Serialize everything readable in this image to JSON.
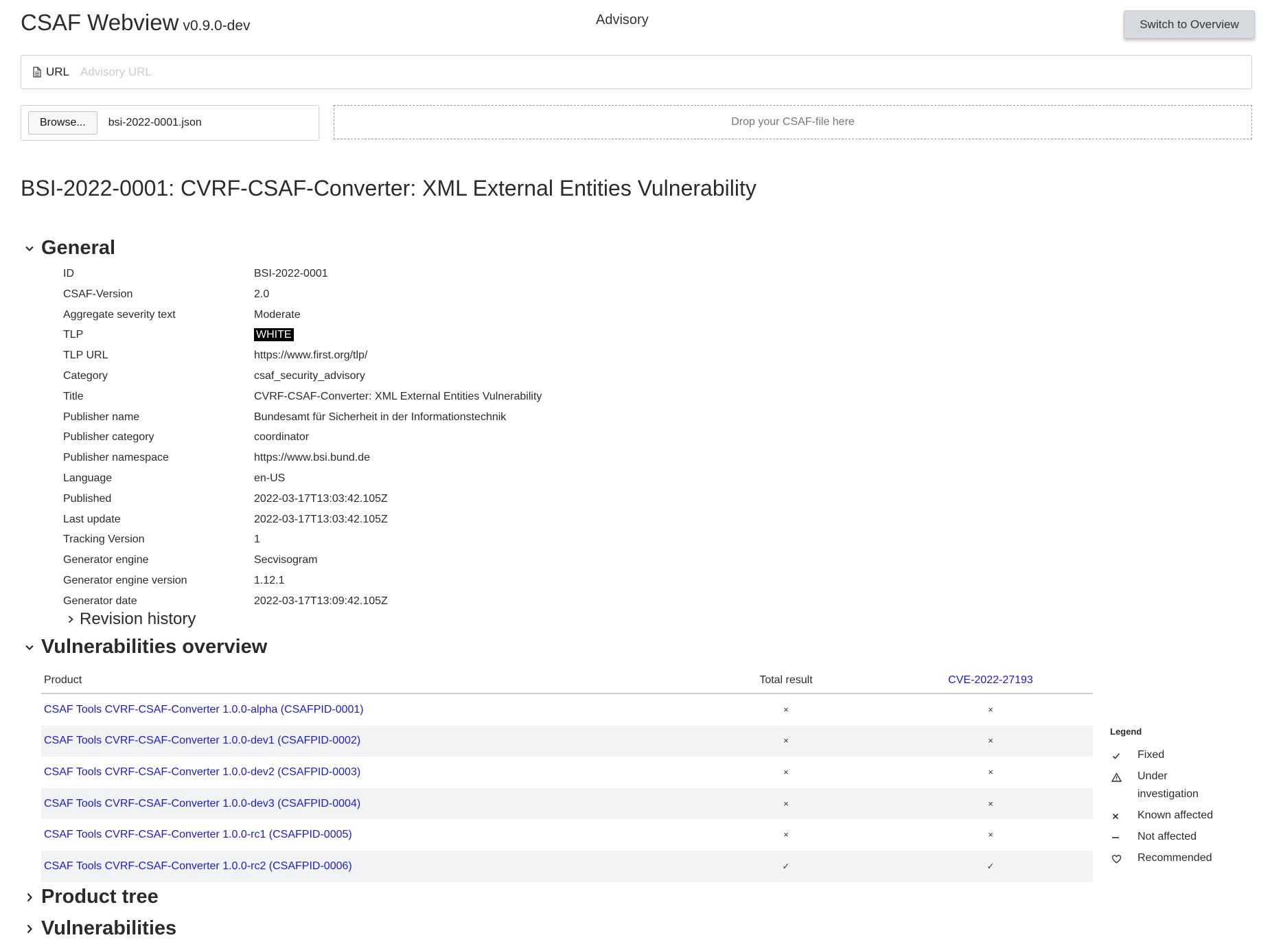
{
  "header": {
    "app_name": "CSAF Webview",
    "version": "v0.9.0-dev",
    "page_label": "Advisory",
    "switch_button": "Switch to Overview"
  },
  "loader": {
    "url_label": "URL",
    "url_placeholder": "Advisory URL",
    "browse_label": "Browse...",
    "file_name": "bsi-2022-0001.json",
    "drop_zone": "Drop your CSAF-file here"
  },
  "document": {
    "title": "BSI-2022-0001: CVRF-CSAF-Converter: XML External Entities Vulnerability"
  },
  "general": {
    "heading": "General",
    "rows": [
      {
        "label": "ID",
        "value": "BSI-2022-0001"
      },
      {
        "label": "CSAF-Version",
        "value": "2.0"
      },
      {
        "label": "Aggregate severity text",
        "value": "Moderate"
      },
      {
        "label": "TLP",
        "value": "WHITE"
      },
      {
        "label": "TLP URL",
        "value": "https://www.first.org/tlp/"
      },
      {
        "label": "Category",
        "value": "csaf_security_advisory"
      },
      {
        "label": "Title",
        "value": "CVRF-CSAF-Converter: XML External Entities Vulnerability"
      },
      {
        "label": "Publisher name",
        "value": "Bundesamt für Sicherheit in der Informationstechnik"
      },
      {
        "label": "Publisher category",
        "value": "coordinator"
      },
      {
        "label": "Publisher namespace",
        "value": "https://www.bsi.bund.de"
      },
      {
        "label": "Language",
        "value": "en-US"
      },
      {
        "label": "Published",
        "value": "2022-03-17T13:03:42.105Z"
      },
      {
        "label": "Last update",
        "value": "2022-03-17T13:03:42.105Z"
      },
      {
        "label": "Tracking Version",
        "value": "1"
      },
      {
        "label": "Generator engine",
        "value": "Secvisogram"
      },
      {
        "label": "Generator engine version",
        "value": "1.12.1"
      },
      {
        "label": "Generator date",
        "value": "2022-03-17T13:09:42.105Z"
      }
    ],
    "revision_history": "Revision history"
  },
  "overview": {
    "heading": "Vulnerabilities overview",
    "columns": {
      "product": "Product",
      "total": "Total result",
      "cve": "CVE-2022-27193"
    },
    "rows": [
      {
        "product": "CSAF Tools CVRF-CSAF-Converter 1.0.0-alpha (CSAFPID-0001)",
        "total": "×",
        "cve": "×"
      },
      {
        "product": "CSAF Tools CVRF-CSAF-Converter 1.0.0-dev1 (CSAFPID-0002)",
        "total": "×",
        "cve": "×"
      },
      {
        "product": "CSAF Tools CVRF-CSAF-Converter 1.0.0-dev2 (CSAFPID-0003)",
        "total": "×",
        "cve": "×"
      },
      {
        "product": "CSAF Tools CVRF-CSAF-Converter 1.0.0-dev3 (CSAFPID-0004)",
        "total": "×",
        "cve": "×"
      },
      {
        "product": "CSAF Tools CVRF-CSAF-Converter 1.0.0-rc1 (CSAFPID-0005)",
        "total": "×",
        "cve": "×"
      },
      {
        "product": "CSAF Tools CVRF-CSAF-Converter 1.0.0-rc2 (CSAFPID-0006)",
        "total": "✓",
        "cve": "✓"
      }
    ]
  },
  "legend": {
    "title": "Legend",
    "items": [
      {
        "icon": "check-icon",
        "label": "Fixed"
      },
      {
        "icon": "warning-triangle-icon",
        "label": "Under investigation"
      },
      {
        "icon": "cross-icon",
        "label": "Known affected"
      },
      {
        "icon": "dash-icon",
        "label": "Not affected"
      },
      {
        "icon": "heart-icon",
        "label": "Recommended"
      }
    ]
  },
  "sections": {
    "product_tree": "Product tree",
    "vulnerabilities": "Vulnerabilities"
  }
}
